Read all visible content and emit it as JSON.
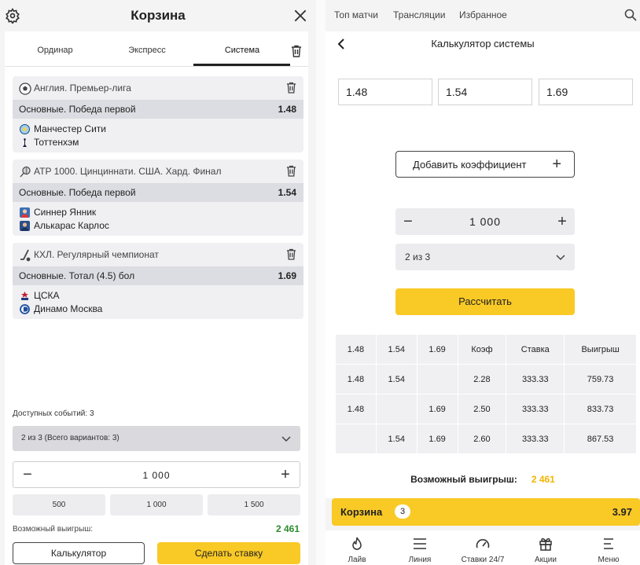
{
  "left": {
    "title": "Корзина",
    "tabs": [
      {
        "label": "Ординар"
      },
      {
        "label": "Экспресс"
      },
      {
        "label": "Система",
        "active": true
      }
    ],
    "events": [
      {
        "league": "Англия. Премьер-лига",
        "market": "Основные. Победа первой",
        "coef": "1.48",
        "team1": "Манчестер Сити",
        "team2": "Тоттенхэм",
        "sport_icon": "soccer-ball-icon"
      },
      {
        "league": "ATP 1000. Цинциннати. США. Хард. Финал",
        "market": "Основные. Победа первой",
        "coef": "1.54",
        "team1": "Синнер Янник",
        "team2": "Алькарас Карлос",
        "sport_icon": "tennis-racket-icon"
      },
      {
        "league": "КХЛ. Регулярный чемпионат",
        "market": "Основные. Тотал (4.5) бол",
        "coef": "1.69",
        "team1": "ЦСКА",
        "team2": "Динамо Москва",
        "sport_icon": "hockey-stick-icon"
      }
    ],
    "available": "Доступных событий: 3",
    "system_select": "2 из 3 (Всего вариантов: 3)",
    "stake": "1 000",
    "quick_stakes": [
      "500",
      "1 000",
      "1 500"
    ],
    "possible_label": "Возможный выигрыш:",
    "possible_value": "2 461",
    "calc_button": "Калькулятор",
    "bet_button": "Сделать ставку"
  },
  "right": {
    "nav": [
      "Топ матчи",
      "Трансляции",
      "Избранное"
    ],
    "title": "Калькулятор системы",
    "coefs": [
      "1.48",
      "1.54",
      "1.69"
    ],
    "add_coef": "Добавить коэффициент",
    "stake": "1 000",
    "system": "2 из 3",
    "calc_button": "Рассчитать",
    "table": {
      "headers": [
        "1.48",
        "1.54",
        "1.69",
        "Коэф",
        "Ставка",
        "Выигрыш"
      ],
      "rows": [
        [
          "1.48",
          "1.54",
          "",
          "2.28",
          "333.33",
          "759.73"
        ],
        [
          "1.48",
          "",
          "1.69",
          "2.50",
          "333.33",
          "833.73"
        ],
        [
          "",
          "1.54",
          "1.69",
          "2.60",
          "333.33",
          "867.53"
        ]
      ]
    },
    "possible_label": "Возможный выигрыш:",
    "possible_value": "2 461",
    "slip": {
      "label": "Корзина",
      "count": "3",
      "value": "3.97"
    },
    "bottom_nav": [
      {
        "label": "Лайв",
        "icon": "flame-icon"
      },
      {
        "label": "Линия",
        "icon": "list-icon"
      },
      {
        "label": "Ставки 24/7",
        "icon": "speedometer-icon"
      },
      {
        "label": "Акции",
        "icon": "gift-icon"
      },
      {
        "label": "Меню",
        "icon": "menu-icon"
      }
    ]
  },
  "colors": {
    "accent_yellow": "#f9c926",
    "win_green": "#2e8b2e",
    "win_orange": "#f4b400",
    "row_grey": "#dcdde2"
  }
}
